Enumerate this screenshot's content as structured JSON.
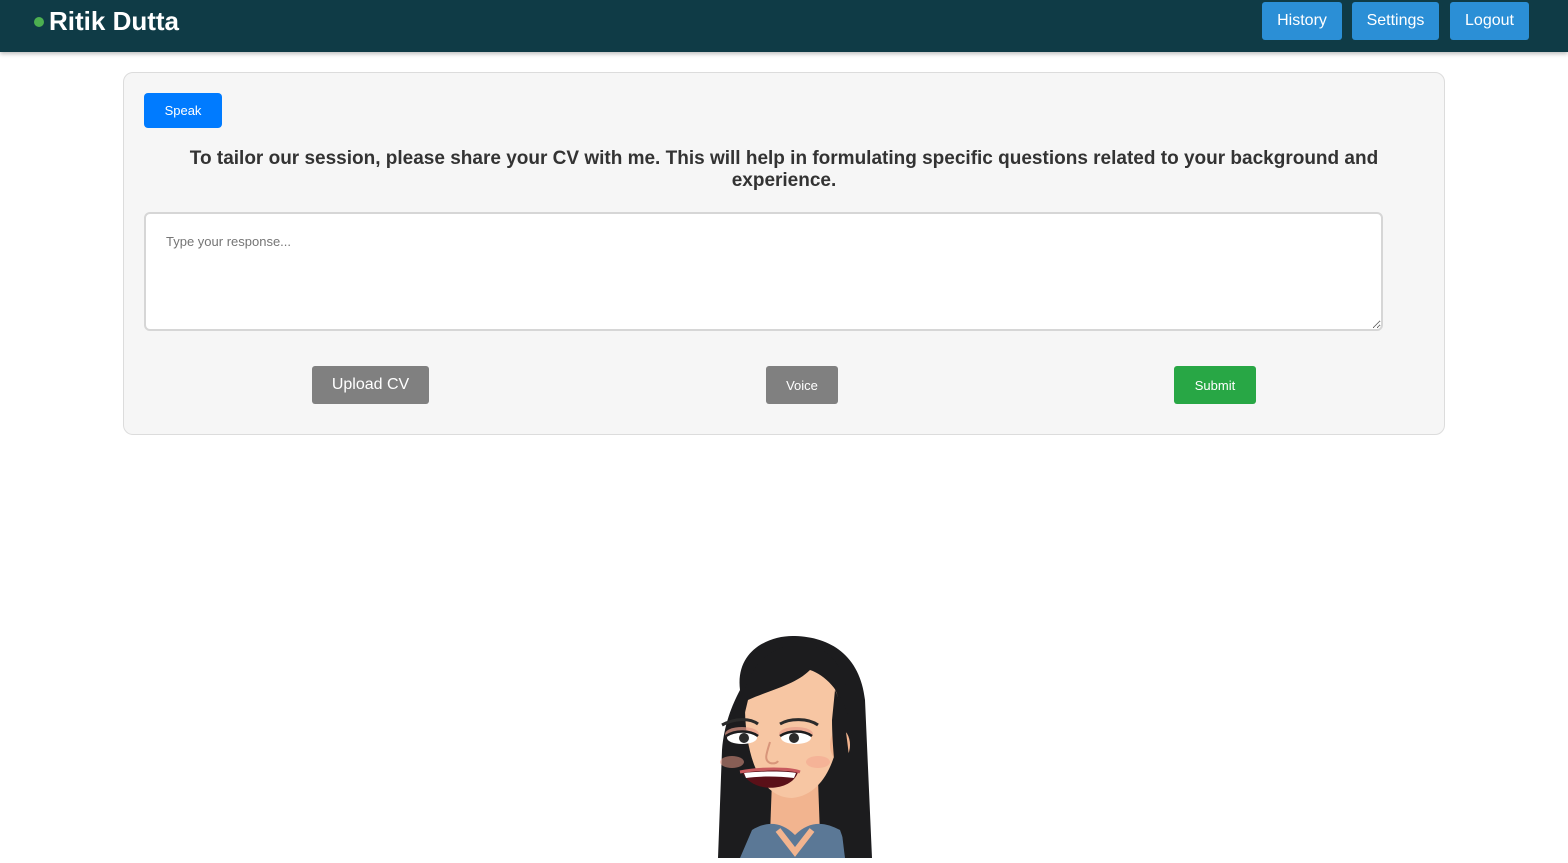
{
  "header": {
    "user_name": "Ritik Dutta",
    "status_color": "#4caf50",
    "nav": {
      "history_label": "History",
      "settings_label": "Settings",
      "logout_label": "Logout"
    }
  },
  "main": {
    "speak_label": "Speak",
    "prompt_text": "To tailor our session, please share your CV with me. This will help in formulating specific questions related to your background and experience.",
    "response": {
      "value": "",
      "placeholder": "Type your response..."
    },
    "upload_label": "Upload CV",
    "voice_label": "Voice",
    "submit_label": "Submit"
  },
  "colors": {
    "navbar": "#0f3b46",
    "nav_button": "#2b8fd6",
    "speak_button": "#007bff",
    "gray_button": "#808080",
    "submit_button": "#28a745"
  },
  "avatar": {
    "icon": "bitmoji-avatar-woman"
  }
}
